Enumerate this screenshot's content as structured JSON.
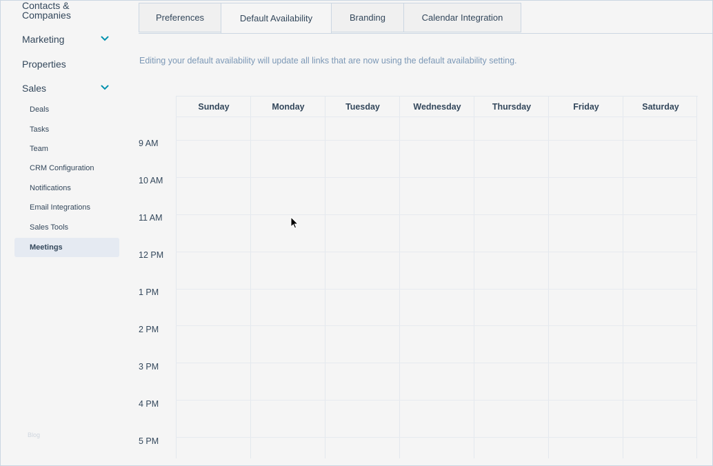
{
  "sidebar": {
    "contacts": "Contacts & Companies",
    "marketing": "Marketing",
    "properties": "Properties",
    "sales": "Sales",
    "sales_items": [
      "Deals",
      "Tasks",
      "Team",
      "CRM Configuration",
      "Notifications",
      "Email Integrations",
      "Sales Tools"
    ],
    "active_item": "Meetings",
    "blog": "Blog"
  },
  "tabs": [
    "Preferences",
    "Default Availability",
    "Branding",
    "Calendar Integration"
  ],
  "active_tab": "Default Availability",
  "info_text": "Editing your default availability will update all links that are now using the default availability setting.",
  "calendar": {
    "days": [
      "Sunday",
      "Monday",
      "Tuesday",
      "Wednesday",
      "Thursday",
      "Friday",
      "Saturday"
    ],
    "times": [
      "9 AM",
      "10 AM",
      "11 AM",
      "12 PM",
      "1 PM",
      "2 PM",
      "3 PM",
      "4 PM",
      "5 PM"
    ]
  },
  "icons": {
    "chevron": "chevron-down-icon",
    "cursor": "mouse-pointer-icon"
  },
  "colors": {
    "accent": "#0091ae",
    "text": "#33475b",
    "muted": "#7c98b6"
  }
}
